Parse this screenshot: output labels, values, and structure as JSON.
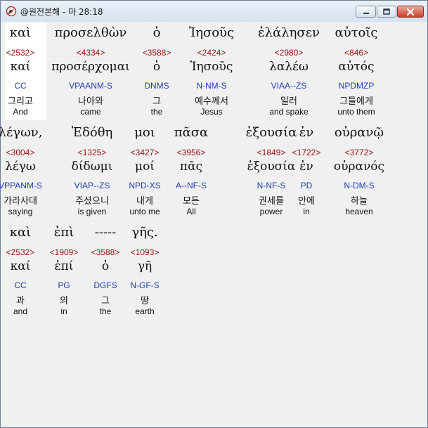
{
  "window": {
    "title": "@원전본해 - 마 28:18",
    "icon": "compass-app-icon",
    "controls": [
      "minimize",
      "maximize",
      "close"
    ]
  },
  "colors": {
    "strong": "#9b0f0f",
    "parse": "#1f3fb6",
    "highlight": "#ffffff"
  },
  "rows": [
    {
      "words": [
        {
          "greek": "καὶ",
          "strong": "<2532>",
          "lex": "καί",
          "parse": "CC",
          "kor": "그리고",
          "eng": "And"
        },
        {
          "greek": "προσελθὼν",
          "strong": "<4334>",
          "lex": "προσέρχομαι",
          "parse": "VPAANM-S",
          "kor": "나아와",
          "eng": "came"
        },
        {
          "greek": "ὁ",
          "strong": "<3588>",
          "lex": "ὁ",
          "parse": "DNMS",
          "kor": "그",
          "eng": "the"
        },
        {
          "greek": "Ἰησοῦς",
          "strong": "<2424>",
          "lex": "Ἰησοῦς",
          "parse": "N-NM-S",
          "kor": "예수께서",
          "eng": "Jesus"
        },
        {
          "greek": "ἐλάλησεν",
          "strong": "<2980>",
          "lex": "λαλέω",
          "parse": "VIAA--ZS",
          "kor": "일러",
          "eng": "and spake"
        },
        {
          "greek": "αὐτοῖς",
          "strong": "<846>",
          "lex": "αὐτός",
          "parse": "NPDMZP",
          "kor": "그들에게",
          "eng": "unto them"
        }
      ]
    },
    {
      "words": [
        {
          "greek": "λέγων,",
          "strong": "<3004>",
          "lex": "λέγω",
          "parse": "VPPANM-S",
          "kor": "가라사대",
          "eng": "saying"
        },
        {
          "greek": "Ἐδόθη",
          "strong": "<1325>",
          "lex": "δίδωμι",
          "parse": "VIAP--ZS",
          "kor": "주셨으니",
          "eng": "is given"
        },
        {
          "greek": "μοι",
          "strong": "<3427>",
          "lex": "μοί",
          "parse": "NPD-XS",
          "kor": "내게",
          "eng": "unto me"
        },
        {
          "greek": "πᾶσα",
          "strong": "<3956>",
          "lex": "πᾶς",
          "parse": "A--NF-S",
          "kor": "모든",
          "eng": "All"
        },
        {
          "greek": "ἐξουσία",
          "strong": "<1849>",
          "lex": "ἐξουσία",
          "parse": "N-NF-S",
          "kor": "권세를",
          "eng": "power"
        },
        {
          "greek": "ἐν",
          "strong": "<1722>",
          "lex": "ἐν",
          "parse": "PD",
          "kor": "안에",
          "eng": "in"
        },
        {
          "greek": "οὐρανῷ",
          "strong": "<3772>",
          "lex": "οὐρανός",
          "parse": "N-DM-S",
          "kor": "하늘",
          "eng": "heaven"
        }
      ]
    },
    {
      "words": [
        {
          "greek": "καὶ",
          "strong": "<2532>",
          "lex": "καί",
          "parse": "CC",
          "kor": "과",
          "eng": "and"
        },
        {
          "greek": "ἐπὶ",
          "strong": "<1909>",
          "lex": "ἐπί",
          "parse": "PG",
          "kor": "의",
          "eng": "in"
        },
        {
          "greek": "-----",
          "strong": "<3588>",
          "lex": "ὁ",
          "parse": "DGFS",
          "kor": "그",
          "eng": "the"
        },
        {
          "greek": "γῆς.",
          "strong": "<1093>",
          "lex": "γῆ",
          "parse": "N-GF-S",
          "kor": "땅",
          "eng": "earth"
        }
      ]
    }
  ]
}
